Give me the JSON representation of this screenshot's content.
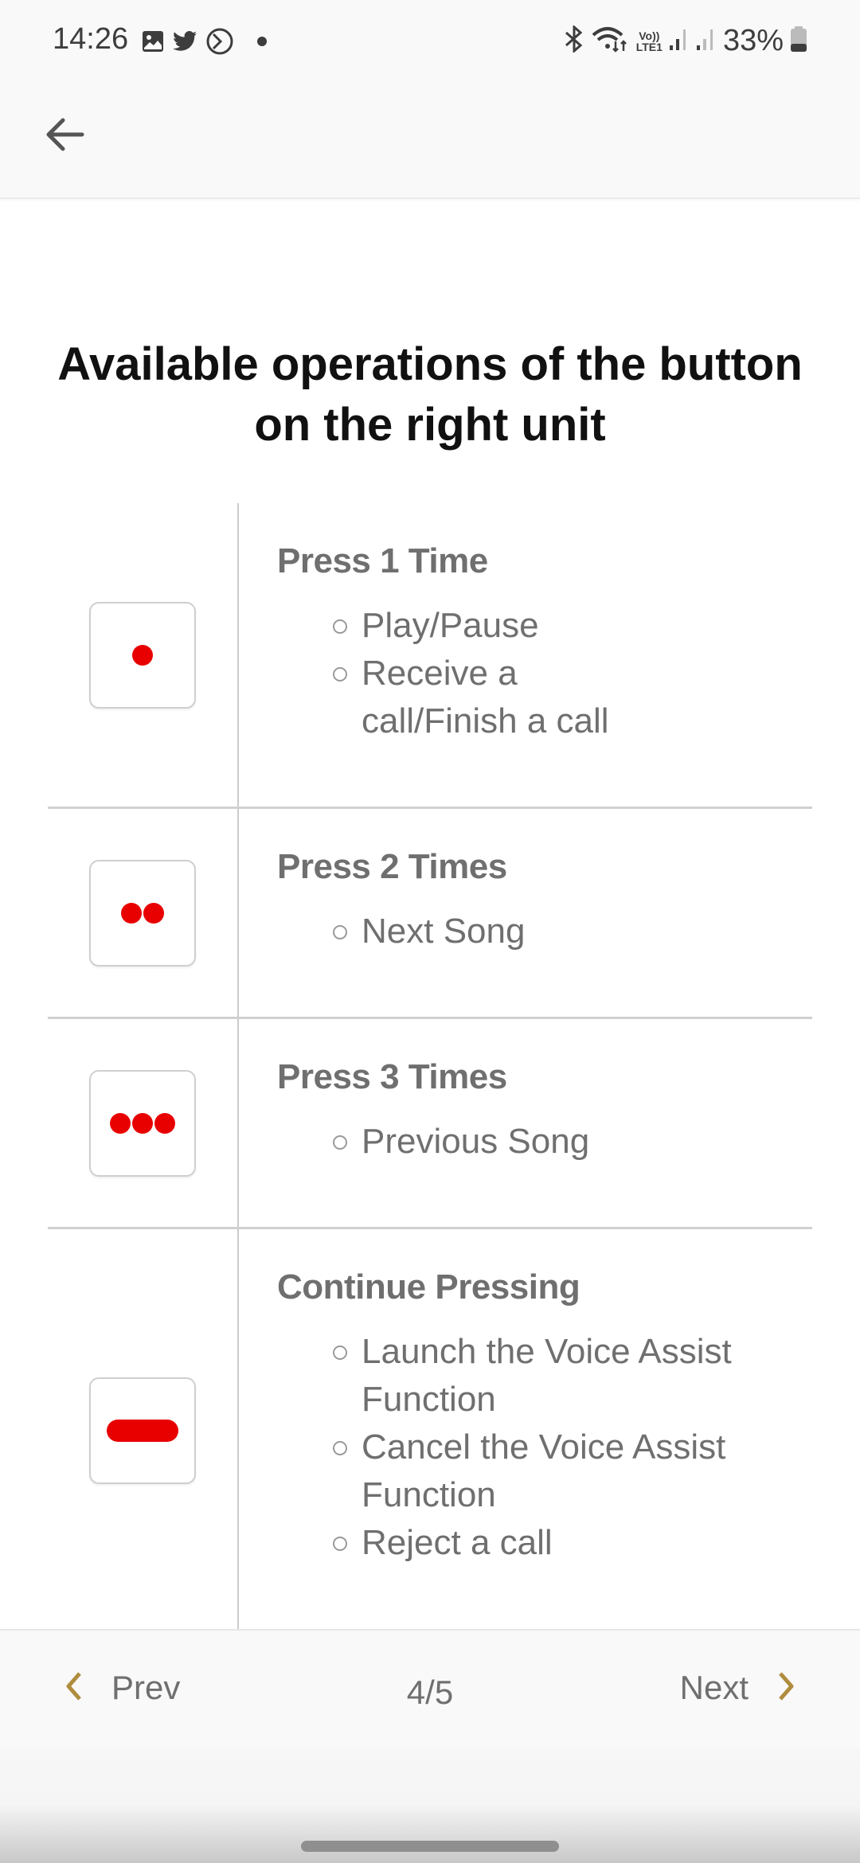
{
  "status_bar": {
    "time": "14:26",
    "left_icons": [
      "gallery-icon",
      "twitter-icon",
      "media-icon",
      "notification-dot-icon"
    ],
    "right_icons": [
      "bluetooth-icon",
      "wifi-icon",
      "volte-icon",
      "signal-sim1-icon",
      "signal-sim2-icon"
    ],
    "volte_top": "Vo))",
    "volte_bottom": "LTE1",
    "battery_percent": "33%",
    "battery_level": 0.33
  },
  "app_bar": {
    "back_icon": "arrow-left-icon"
  },
  "page": {
    "title": "Available operations of the button on the right unit"
  },
  "operations": [
    {
      "icon": "single-dot-icon",
      "title": "Press 1 Time",
      "actions": [
        "Play/Pause",
        "Receive a call/Finish a call"
      ]
    },
    {
      "icon": "double-dot-icon",
      "title": "Press 2 Times",
      "actions": [
        "Next Song"
      ]
    },
    {
      "icon": "triple-dot-icon",
      "title": "Press 3 Times",
      "actions": [
        "Previous Song"
      ]
    },
    {
      "icon": "long-press-bar-icon",
      "title": "Continue Pressing",
      "actions": [
        "Launch the Voice Assist Function",
        "Cancel the Voice Assist Function",
        "Reject a call"
      ]
    }
  ],
  "footer": {
    "prev_label": "Prev",
    "next_label": "Next",
    "page_indicator": "4/5",
    "current_page": 4,
    "total_pages": 5,
    "accent_color": "#b08d3e"
  },
  "colors": {
    "dot_red": "#e80000",
    "text_gray": "#6f6f6f"
  }
}
